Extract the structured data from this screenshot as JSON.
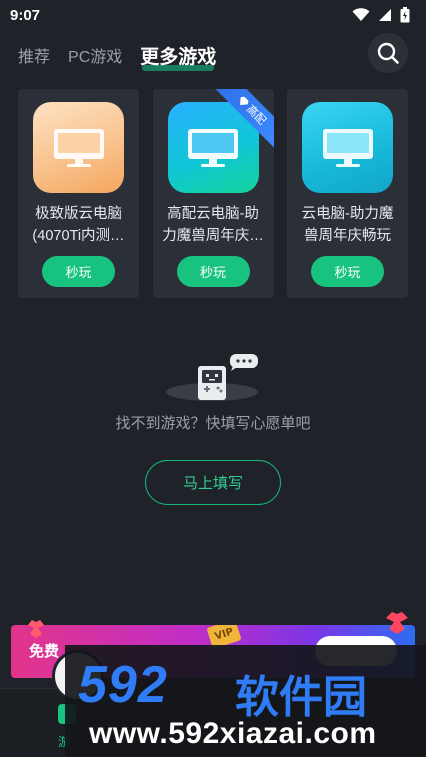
{
  "status_bar": {
    "time": "9:07"
  },
  "tabs": [
    {
      "label": "推荐",
      "active": false
    },
    {
      "label": "PC游戏",
      "active": false
    },
    {
      "label": "更多游戏",
      "active": true
    }
  ],
  "cards": [
    {
      "title": "极致版云电脑(4070Ti内测…",
      "button": "秒玩",
      "icon": "monitor-icon",
      "icon_style": "orange",
      "badge": ""
    },
    {
      "title": "高配云电脑-助力魔兽周年庆…",
      "button": "秒玩",
      "icon": "monitor-icon",
      "icon_style": "blue",
      "badge": "高配"
    },
    {
      "title": "云电脑-助力魔兽周年庆畅玩",
      "button": "秒玩",
      "icon": "monitor-icon",
      "icon_style": "cyan",
      "badge": ""
    }
  ],
  "empty_state": {
    "message": "找不到游戏？快填写心愿单吧",
    "button_label": "马上填写"
  },
  "promo": {
    "text": "免费",
    "vip_tag": "VIP"
  },
  "bottom_nav": {
    "active_label": "游"
  },
  "watermark": {
    "logo": "592",
    "name": "软件园",
    "url": "www.592xiazai.com"
  },
  "colors": {
    "background": "#1f2329",
    "accent_green": "#18c27f",
    "card_bg": "#2b3038",
    "ribbon_blue": "#2f6ee8",
    "watermark_blue": "#2f7cf6"
  }
}
